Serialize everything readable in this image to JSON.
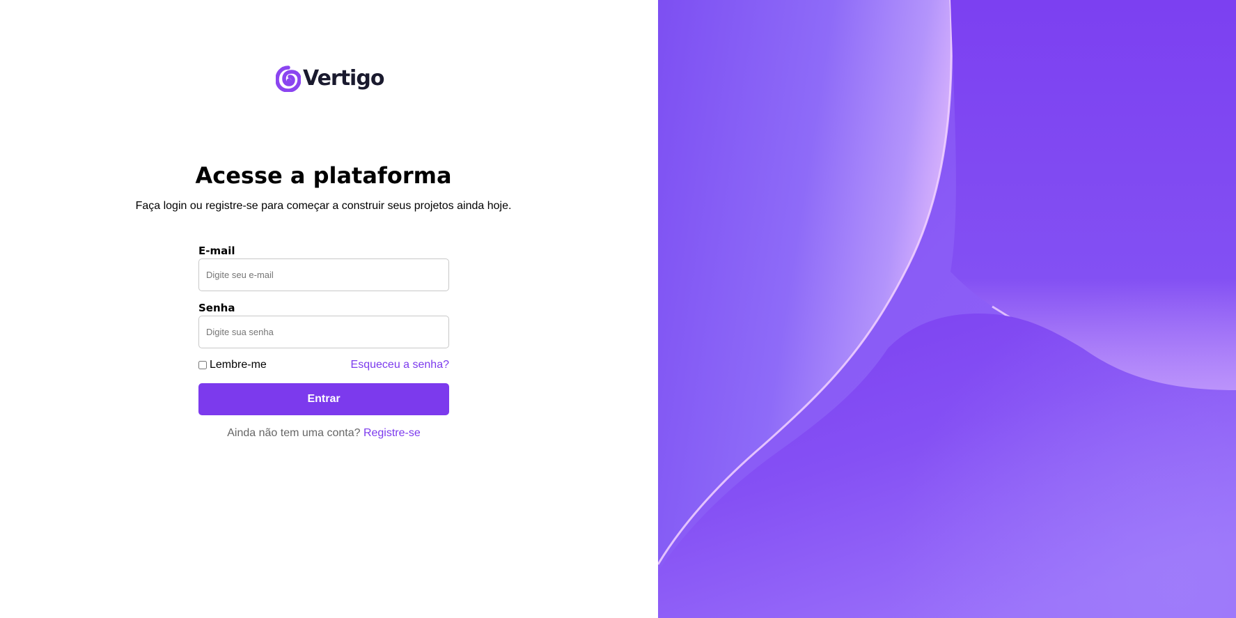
{
  "brand": {
    "name": "Vertigo",
    "logo_icon": "vertigo-swirl-icon",
    "accent_color": "#7c3aed"
  },
  "login": {
    "title": "Acesse a plataforma",
    "subtitle": "Faça login ou registre-se para começar a construir seus projetos ainda hoje.",
    "email": {
      "label": "E-mail",
      "placeholder": "Digite seu e-mail",
      "value": ""
    },
    "password": {
      "label": "Senha",
      "placeholder": "Digite sua senha",
      "value": ""
    },
    "remember_label": "Lembre-me",
    "remember_checked": false,
    "forgot_label": "Esqueceu a senha?",
    "submit_label": "Entrar",
    "signup_prompt": "Ainda não tem uma conta?",
    "signup_link": "Registre-se"
  },
  "hero": {
    "colors": {
      "base": "#7b3ff0",
      "light": "#a98bfa",
      "highlight": "#f0c8ff"
    }
  }
}
